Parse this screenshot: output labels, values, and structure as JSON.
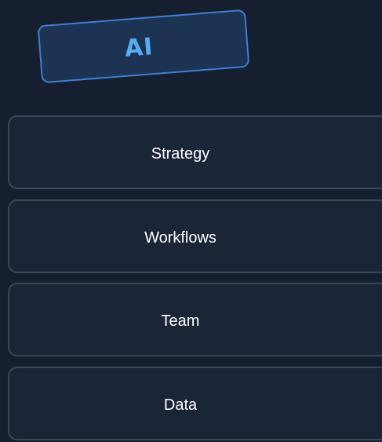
{
  "badge": {
    "label": "AI"
  },
  "items": [
    {
      "label": "Strategy"
    },
    {
      "label": "Workflows"
    },
    {
      "label": "Team"
    },
    {
      "label": "Data"
    }
  ],
  "colors": {
    "background": "#161f30",
    "badge_fill": "#1d3354",
    "badge_border": "#3f7ed2",
    "badge_text": "#55aef3",
    "item_fill": "#1b2538",
    "item_border": "#3c4658",
    "item_text": "#ffffff"
  }
}
